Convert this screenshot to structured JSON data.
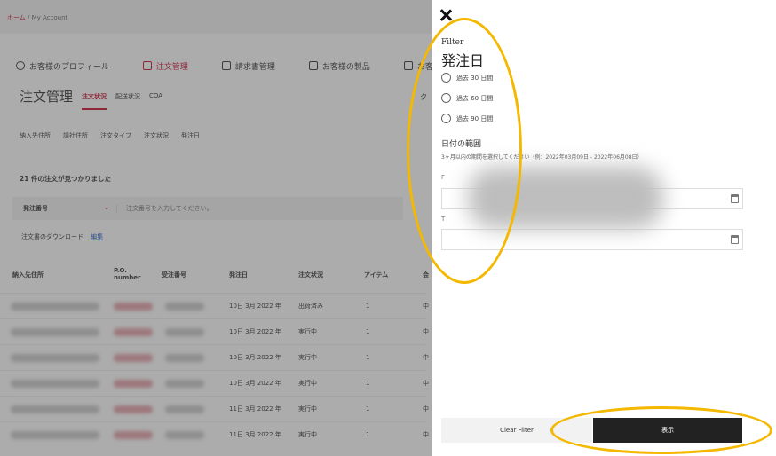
{
  "breadcrumb": {
    "home": "ホーム",
    "separator": "/",
    "current": "My Account"
  },
  "nav": {
    "profile": "お客様のプロフィール",
    "orders": "注文管理",
    "invoices": "請求書管理",
    "products": "お客様の製品",
    "partial": "お客様"
  },
  "page": {
    "title": "注文管理",
    "tabs": [
      "注文状況",
      "配送状況",
      "COA"
    ],
    "partial_right": "ク"
  },
  "filters": [
    "納入先住所",
    "請社住所",
    "注文タイプ",
    "注文状況",
    "発注日"
  ],
  "results": {
    "count_text": "21 件の注文が見つかりました"
  },
  "search": {
    "select_label": "発注番号",
    "placeholder": "注文番号を入力してください。"
  },
  "download": {
    "link": "注文書のダウンロード",
    "edit": "編集"
  },
  "table": {
    "headers": [
      "納入先住所",
      "P.O. number",
      "受注番号",
      "発注日",
      "注文状況",
      "アイテム",
      "会"
    ],
    "rows": [
      {
        "date": "10日 3月 2022 年",
        "status": "出荷済み",
        "items": "1",
        "col": "中"
      },
      {
        "date": "10日 3月 2022 年",
        "status": "実行中",
        "items": "1",
        "col": "中"
      },
      {
        "date": "10日 3月 2022 年",
        "status": "実行中",
        "items": "1",
        "col": "中"
      },
      {
        "date": "10日 3月 2022 年",
        "status": "実行中",
        "items": "1",
        "col": "中"
      },
      {
        "date": "11日 3月 2022 年",
        "status": "実行中",
        "items": "1",
        "col": "中"
      },
      {
        "date": "11日 3月 2022 年",
        "status": "実行中",
        "items": "1",
        "col": "中"
      }
    ]
  },
  "panel": {
    "label": "Filter",
    "title": "発注日",
    "options": [
      "過去 30 日間",
      "過去 60 日間",
      "過去 90 日間"
    ],
    "range_title": "日付の範囲",
    "range_hint": "3ヶ月以内の期間を選択してください（例：2022年03月09日 - 2022年06月08日）",
    "from_initial": "F",
    "to_initial": "T",
    "clear_label": "Clear Filter",
    "apply_label": "表示"
  },
  "colors": {
    "accent": "#c8102e",
    "highlight": "#f5b800",
    "button_dark": "#222222"
  }
}
